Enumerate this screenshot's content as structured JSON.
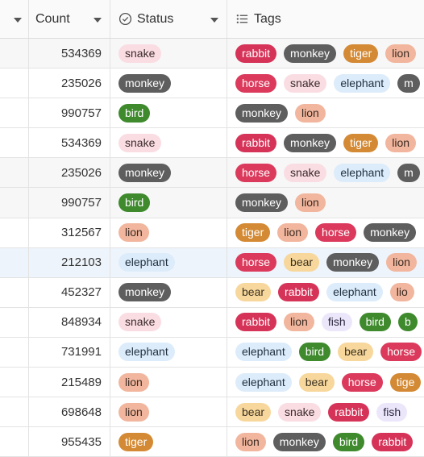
{
  "header": {
    "count_label": "Count",
    "status_label": "Status",
    "tags_label": "Tags",
    "icons": {
      "status": "circle-check-icon",
      "tags": "list-icon",
      "sort": "caret-down-icon"
    }
  },
  "tag_colors": {
    "rabbit": "#d63358",
    "monkey": "#5e5e5e",
    "tiger": "#d48a34",
    "lion": "#f1b69d",
    "horse": "#db3a5c",
    "snake": "#fadde3",
    "elephant": "#ddecfa",
    "bird": "#3e8a2d",
    "bear": "#f7d79b",
    "fish": "#ece6fb"
  },
  "rows": [
    {
      "count": "534369",
      "status": "snake",
      "tags": [
        "rabbit",
        "monkey",
        "tiger",
        "lion"
      ]
    },
    {
      "count": "235026",
      "status": "monkey",
      "tags": [
        "horse",
        "snake",
        "elephant",
        "m"
      ]
    },
    {
      "count": "990757",
      "status": "bird",
      "tags": [
        "monkey",
        "lion"
      ]
    },
    {
      "count": "534369",
      "status": "snake",
      "tags": [
        "rabbit",
        "monkey",
        "tiger",
        "lion"
      ]
    },
    {
      "count": "235026",
      "status": "monkey",
      "tags": [
        "horse",
        "snake",
        "elephant",
        "m"
      ]
    },
    {
      "count": "990757",
      "status": "bird",
      "tags": [
        "monkey",
        "lion"
      ]
    },
    {
      "count": "312567",
      "status": "lion",
      "tags": [
        "tiger",
        "lion",
        "horse",
        "monkey"
      ]
    },
    {
      "count": "212103",
      "status": "elephant",
      "tags": [
        "horse",
        "bear",
        "monkey",
        "lion"
      ]
    },
    {
      "count": "452327",
      "status": "monkey",
      "tags": [
        "bear",
        "rabbit",
        "elephant",
        "lio"
      ]
    },
    {
      "count": "848934",
      "status": "snake",
      "tags": [
        "rabbit",
        "lion",
        "fish",
        "bird",
        "b"
      ]
    },
    {
      "count": "731991",
      "status": "elephant",
      "tags": [
        "elephant",
        "bird",
        "bear",
        "horse"
      ]
    },
    {
      "count": "215489",
      "status": "lion",
      "tags": [
        "elephant",
        "bear",
        "horse",
        "tige"
      ]
    },
    {
      "count": "698648",
      "status": "lion",
      "tags": [
        "bear",
        "snake",
        "rabbit",
        "fish"
      ]
    },
    {
      "count": "955435",
      "status": "tiger",
      "tags": [
        "lion",
        "monkey",
        "bird",
        "rabbit"
      ]
    }
  ]
}
